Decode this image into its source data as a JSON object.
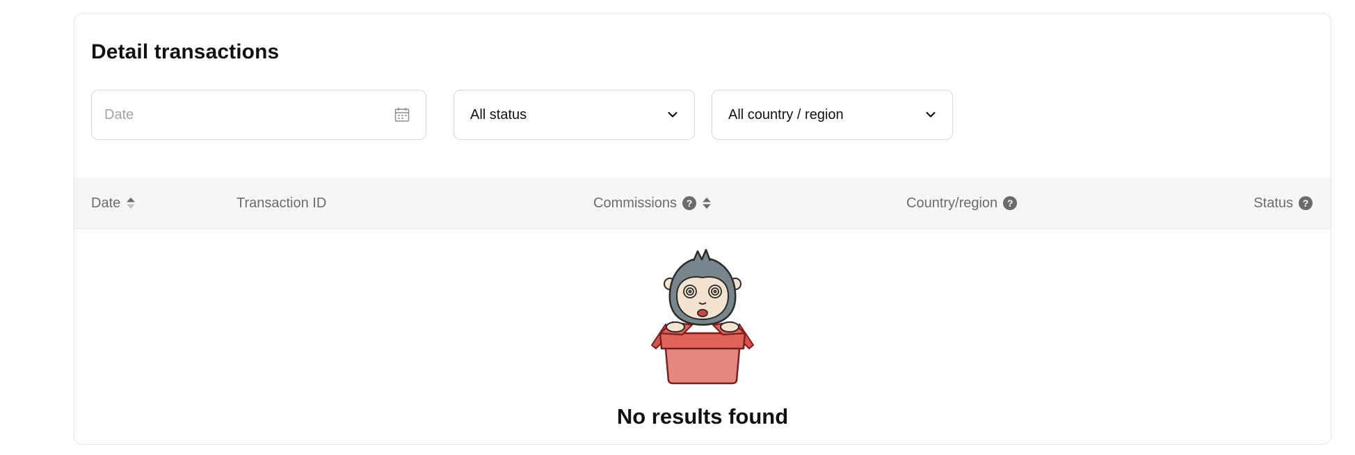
{
  "section": {
    "title": "Detail transactions"
  },
  "filters": {
    "date_placeholder": "Date",
    "status_value": "All status",
    "country_value": "All country / region"
  },
  "table": {
    "columns": [
      "Date",
      "Transaction ID",
      "Commissions",
      "Country/region",
      "Status"
    ],
    "rows": []
  },
  "empty_state": {
    "message": "No results found"
  },
  "icons": {
    "date_filter": "calendar-icon",
    "dropdown": "chevron-down-icon",
    "help": "question-mark-icon",
    "sort": "sort-icon",
    "empty_illustration": "gorilla-in-box-illustration"
  },
  "colors": {
    "header_bg": "#f6f6f7",
    "box_red": "#e0635a",
    "gorilla_gray": "#76868c"
  }
}
